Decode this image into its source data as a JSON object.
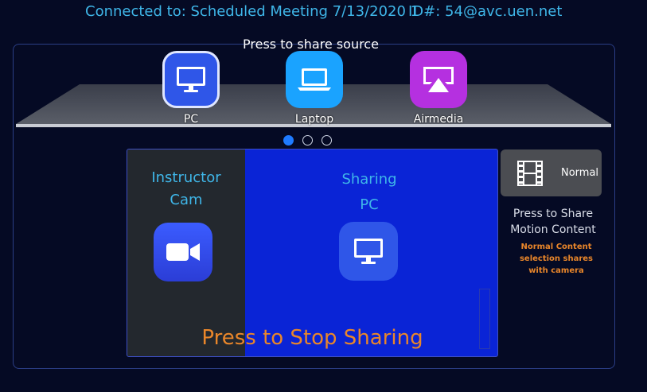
{
  "header": {
    "connected": "Connected to:  Scheduled Meeting 7/13/2020 1",
    "id": "ID#:  54@avc.uen.net"
  },
  "share": {
    "title": "Press to share source",
    "sources": [
      {
        "label": "PC",
        "icon": "monitor-icon",
        "color": "#2f56e8",
        "selected": true
      },
      {
        "label": "Laptop",
        "icon": "laptop-icon",
        "color": "#1aa3ff",
        "selected": false
      },
      {
        "label": "Airmedia",
        "icon": "airplay-icon",
        "color": "#b530e0",
        "selected": false
      }
    ],
    "page_dots": {
      "count": 3,
      "active": 0
    }
  },
  "content": {
    "instructor_line1": "Instructor",
    "instructor_line2": "Cam",
    "sharing_line1": "Sharing",
    "sharing_line2": "PC",
    "stop_label": "Press to Stop Sharing"
  },
  "side": {
    "normal_label": "Normal",
    "motion_line1": "Press to Share",
    "motion_line2": "Motion Content",
    "note_line1": "Normal Content",
    "note_line2": "selection shares",
    "note_line3": "with camera"
  },
  "colors": {
    "accent": "#3fb6e8",
    "stop": "#e9862a",
    "sharing_bg": "#0a24d6"
  }
}
